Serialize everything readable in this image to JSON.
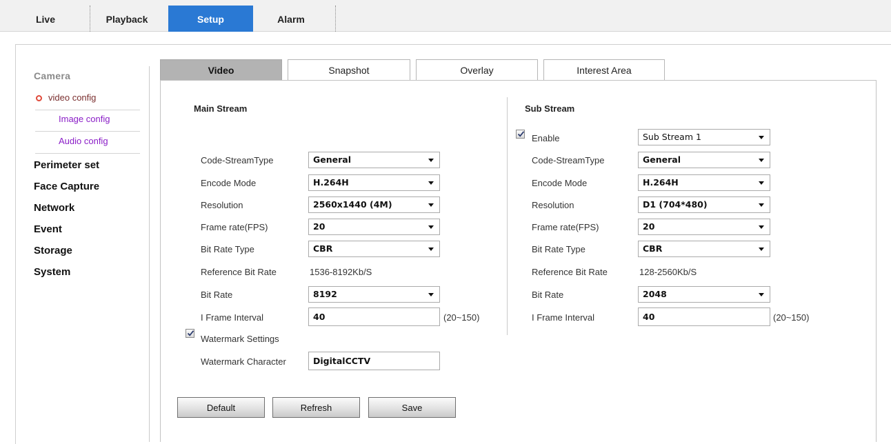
{
  "topnav": {
    "tabs": [
      {
        "label": "Live"
      },
      {
        "label": "Playback"
      },
      {
        "label": "Setup"
      },
      {
        "label": "Alarm"
      }
    ]
  },
  "sidebar": {
    "camera_label": "Camera",
    "sub_items": [
      {
        "label": "video config"
      },
      {
        "label": "Image config"
      },
      {
        "label": "Audio config"
      }
    ],
    "main_items": [
      {
        "label": "Perimeter set"
      },
      {
        "label": "Face Capture"
      },
      {
        "label": "Network"
      },
      {
        "label": "Event"
      },
      {
        "label": "Storage"
      },
      {
        "label": "System"
      }
    ]
  },
  "content_tabs": [
    {
      "label": "Video"
    },
    {
      "label": "Snapshot"
    },
    {
      "label": "Overlay"
    },
    {
      "label": "Interest Area"
    }
  ],
  "main_stream": {
    "heading": "Main Stream",
    "code_stream_type": {
      "label": "Code-StreamType",
      "value": "General"
    },
    "encode_mode": {
      "label": "Encode Mode",
      "value": "H.264H"
    },
    "resolution": {
      "label": "Resolution",
      "value": "2560x1440 (4M)"
    },
    "frame_rate": {
      "label": "Frame rate(FPS)",
      "value": "20"
    },
    "bit_rate_type": {
      "label": "Bit Rate Type",
      "value": "CBR"
    },
    "reference_bit_rate": {
      "label": "Reference Bit Rate",
      "value": "1536-8192Kb/S"
    },
    "bit_rate": {
      "label": "Bit Rate",
      "value": "8192"
    },
    "i_frame_interval": {
      "label": "I Frame Interval",
      "value": "40",
      "range": "(20~150)"
    },
    "watermark_settings": {
      "label": "Watermark Settings",
      "checked": true
    },
    "watermark_character": {
      "label": "Watermark Character",
      "value": "DigitalCCTV"
    }
  },
  "sub_stream": {
    "heading": "Sub Stream",
    "enable": {
      "label": "Enable",
      "checked": true,
      "value": "Sub Stream 1"
    },
    "code_stream_type": {
      "label": "Code-StreamType",
      "value": "General"
    },
    "encode_mode": {
      "label": "Encode Mode",
      "value": "H.264H"
    },
    "resolution": {
      "label": "Resolution",
      "value": "D1 (704*480)"
    },
    "frame_rate": {
      "label": "Frame rate(FPS)",
      "value": "20"
    },
    "bit_rate_type": {
      "label": "Bit Rate Type",
      "value": "CBR"
    },
    "reference_bit_rate": {
      "label": "Reference Bit Rate",
      "value": "128-2560Kb/S"
    },
    "bit_rate": {
      "label": "Bit Rate",
      "value": "2048"
    },
    "i_frame_interval": {
      "label": "I Frame Interval",
      "value": "40",
      "range": "(20~150)"
    }
  },
  "buttons": {
    "default": "Default",
    "refresh": "Refresh",
    "save": "Save"
  },
  "colors": {
    "active_tab": "#2a79d4",
    "active_content_tab": "#b3b3b3",
    "sidebar_sub_link": "#8a1dc7",
    "sidebar_bullet": "#e04a3a"
  }
}
